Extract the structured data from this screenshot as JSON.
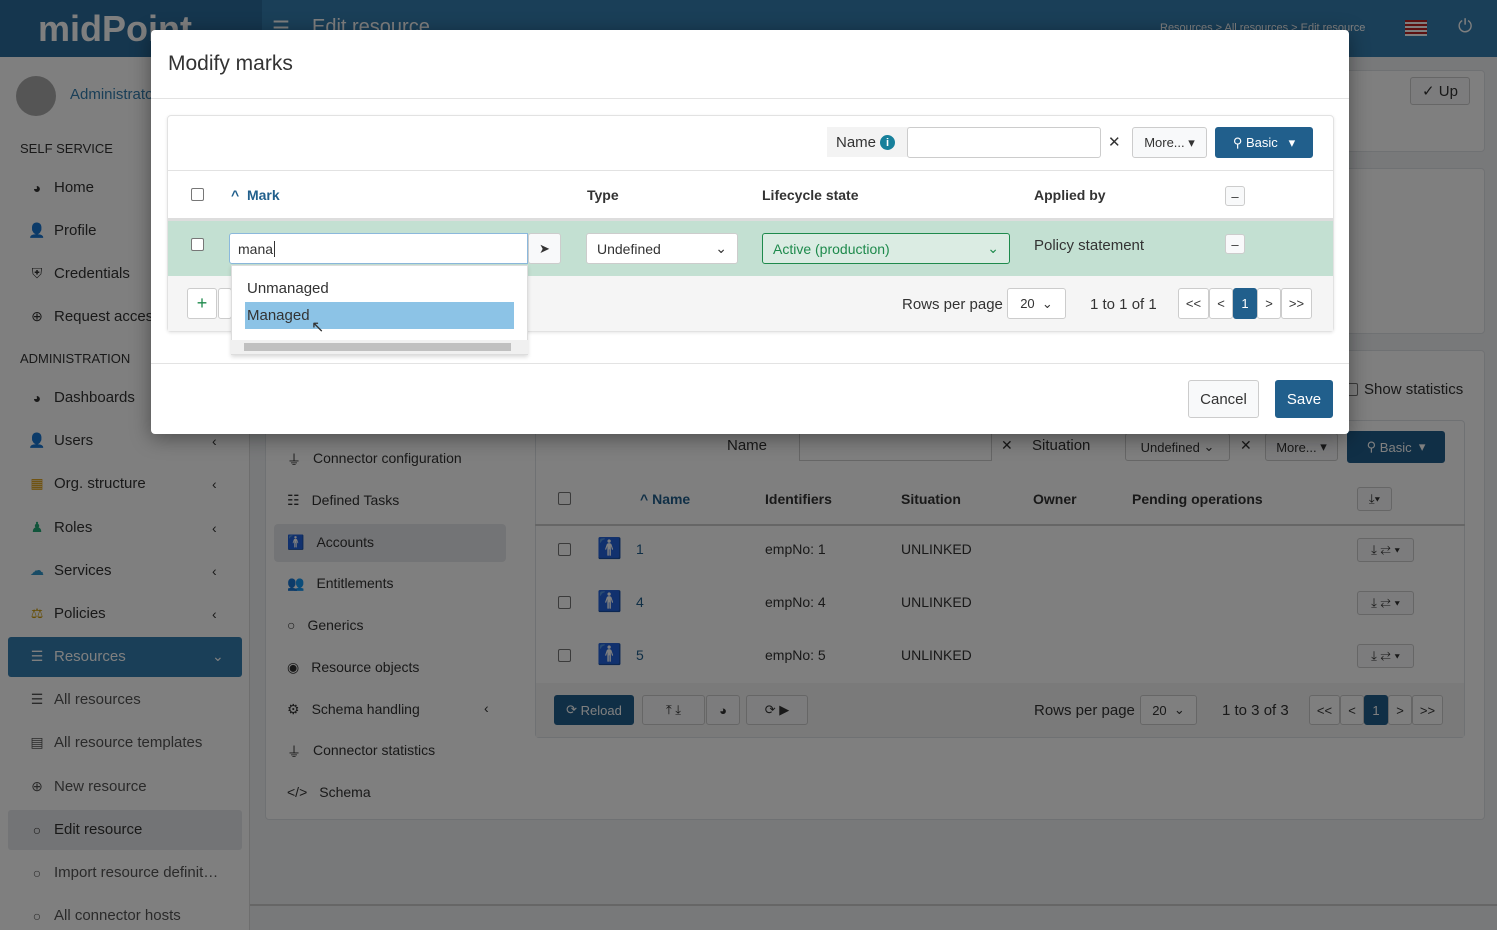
{
  "header": {
    "logo": "midPoint",
    "title": "Edit resource",
    "breadcrumbs": "Resources > All resources > Edit resource"
  },
  "sidebar": {
    "user": "Administrator",
    "self_service": "SELF SERVICE",
    "self_items": [
      "Home",
      "Profile",
      "Credentials",
      "Request access"
    ],
    "administration": "ADMINISTRATION",
    "admin_items": [
      "Dashboards",
      "Users",
      "Org. structure",
      "Roles",
      "Services",
      "Policies",
      "Resources"
    ],
    "resource_items": [
      "All resources",
      "All resource templates",
      "New resource",
      "Edit resource",
      "Import resource definit…",
      "All connector hosts"
    ]
  },
  "page": {
    "up_button": "Up",
    "show_statistics": "Show statistics",
    "resource_menu": [
      "Connector configuration",
      "Defined Tasks",
      "Accounts",
      "Entitlements",
      "Generics",
      "Resource objects",
      "Schema handling",
      "Connector statistics",
      "Schema"
    ],
    "search": {
      "name_label": "Name",
      "situation_label": "Situation",
      "situation_value": "Undefined",
      "more": "More...",
      "basic": "Basic"
    },
    "columns": [
      "Name",
      "Identifiers",
      "Situation",
      "Owner",
      "Pending operations"
    ],
    "rows": [
      {
        "name": "1",
        "identifiers": "empNo: 1",
        "situation": "UNLINKED"
      },
      {
        "name": "4",
        "identifiers": "empNo: 4",
        "situation": "UNLINKED"
      },
      {
        "name": "5",
        "identifiers": "empNo: 5",
        "situation": "UNLINKED"
      }
    ],
    "reload": "Reload",
    "rows_per_page": "Rows per page",
    "page_size": "20",
    "count": "1 to 3 of 3",
    "pager": [
      "<<",
      "<",
      "1",
      ">",
      ">>"
    ]
  },
  "modal": {
    "title": "Modify marks",
    "search": {
      "name_label": "Name",
      "more": "More...",
      "basic": "Basic",
      "name_value": ""
    },
    "columns": {
      "mark": "Mark",
      "type": "Type",
      "lifecycle": "Lifecycle state",
      "applied_by": "Applied by"
    },
    "row": {
      "mark_input": "mana",
      "type": "Undefined",
      "lifecycle": "Active (production)",
      "applied_by": "Policy statement"
    },
    "autocomplete": [
      "Unmanaged",
      "Managed"
    ],
    "rows_per_page": "Rows per page",
    "page_size": "20",
    "count": "1 to 1 of 1",
    "pager": [
      "<<",
      "<",
      "1",
      ">",
      ">>"
    ],
    "cancel": "Cancel",
    "save": "Save"
  },
  "colors": {
    "primary": "#215f8c",
    "header": "#357fb1",
    "row_highlight": "#c3e0d2",
    "lifecycle_green": "#1e8a4c",
    "autocomplete_selected": "#8cc3e6"
  }
}
